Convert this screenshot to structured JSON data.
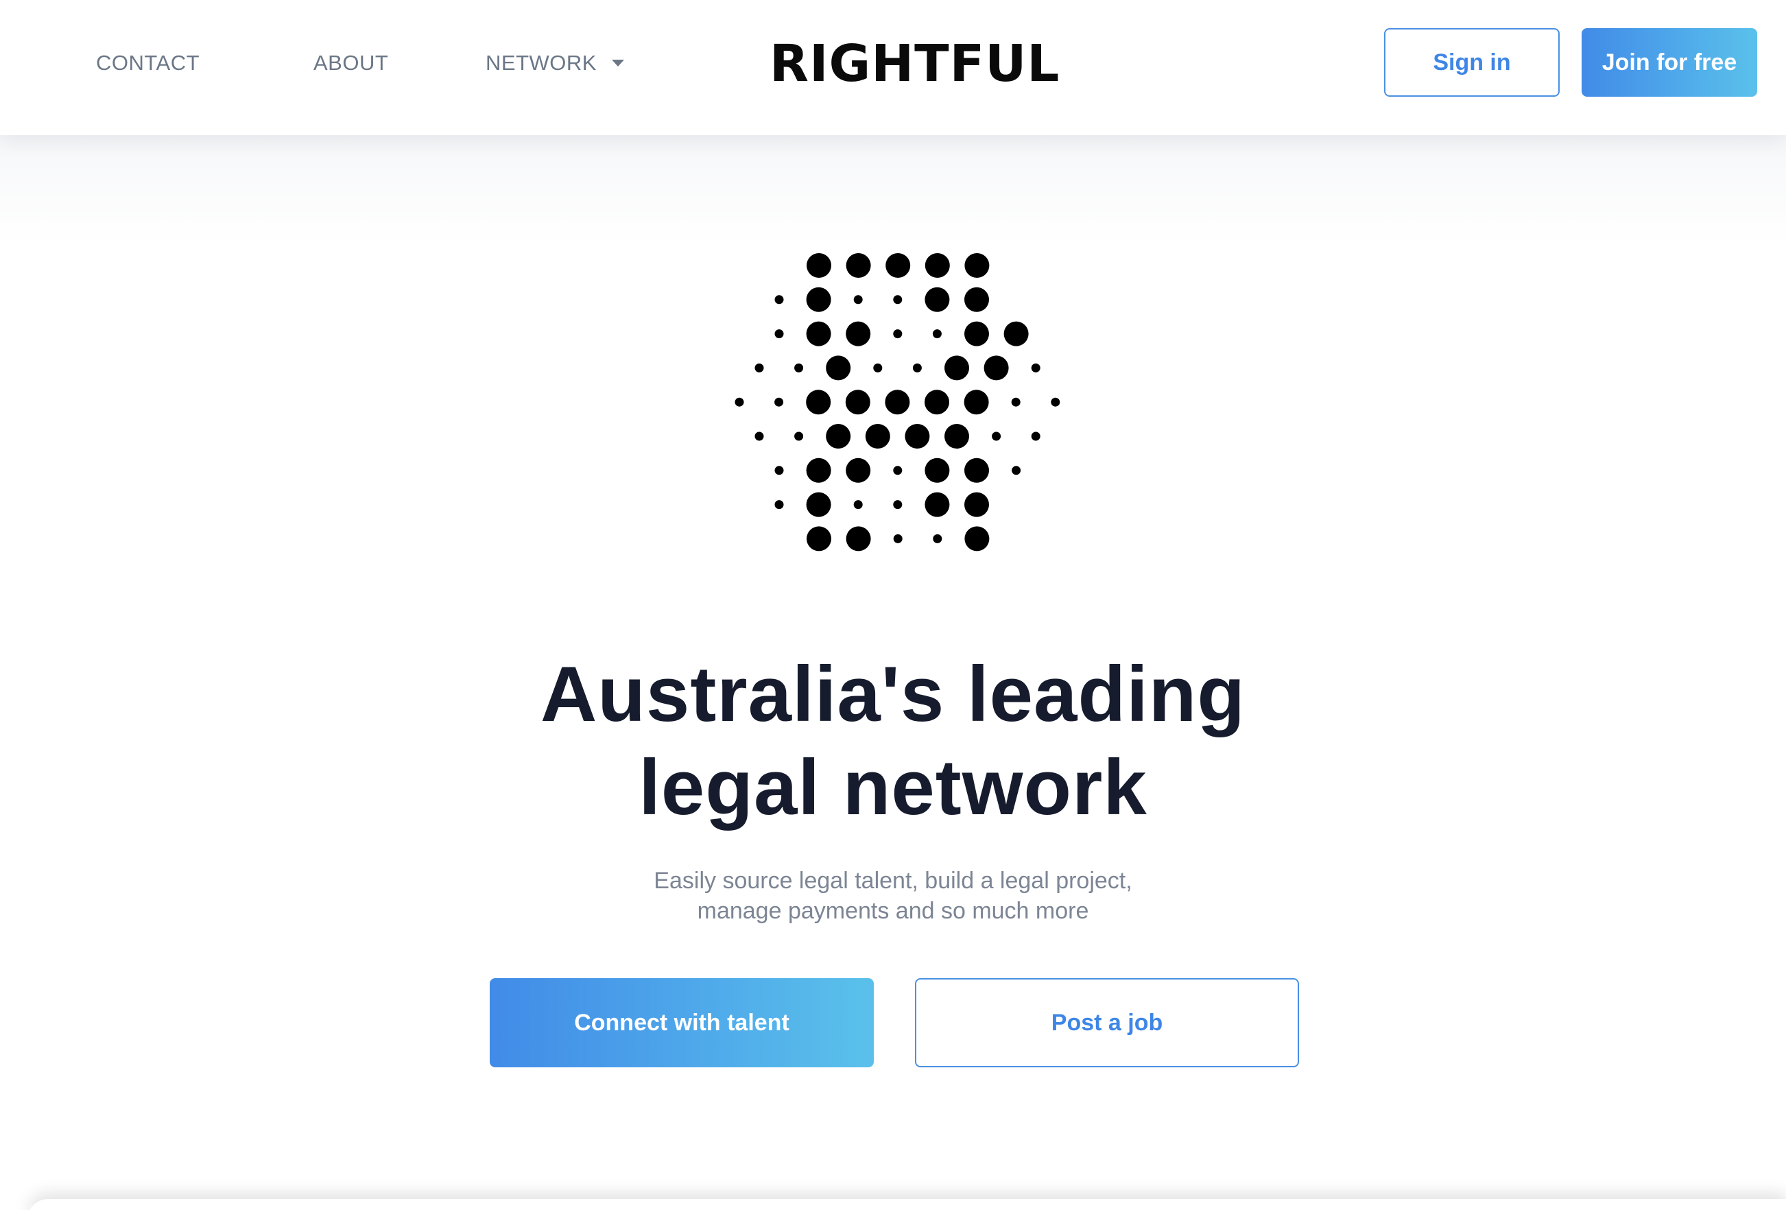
{
  "nav": {
    "contact": "CONTACT",
    "about": "ABOUT",
    "network": "NETWORK"
  },
  "brand": {
    "name": "RIGHTFUL"
  },
  "header_actions": {
    "sign_in": "Sign in",
    "join": "Join for free"
  },
  "hero": {
    "headline_line1": "Australia's leading",
    "headline_line2": "legal network",
    "sub_line1": "Easily source legal talent, build a legal project,",
    "sub_line2": "manage payments and so much more",
    "primary_cta": "Connect with talent",
    "secondary_cta": "Post a job"
  },
  "icons": {
    "network_dropdown": "chevron-down-icon",
    "logo_mark": "dot-hexagon-logo"
  },
  "colors": {
    "accent_start": "#418be8",
    "accent_end": "#5ac1eb",
    "heading": "#161c2d",
    "muted_text": "#7c8594",
    "nav_text": "#6b7787"
  }
}
